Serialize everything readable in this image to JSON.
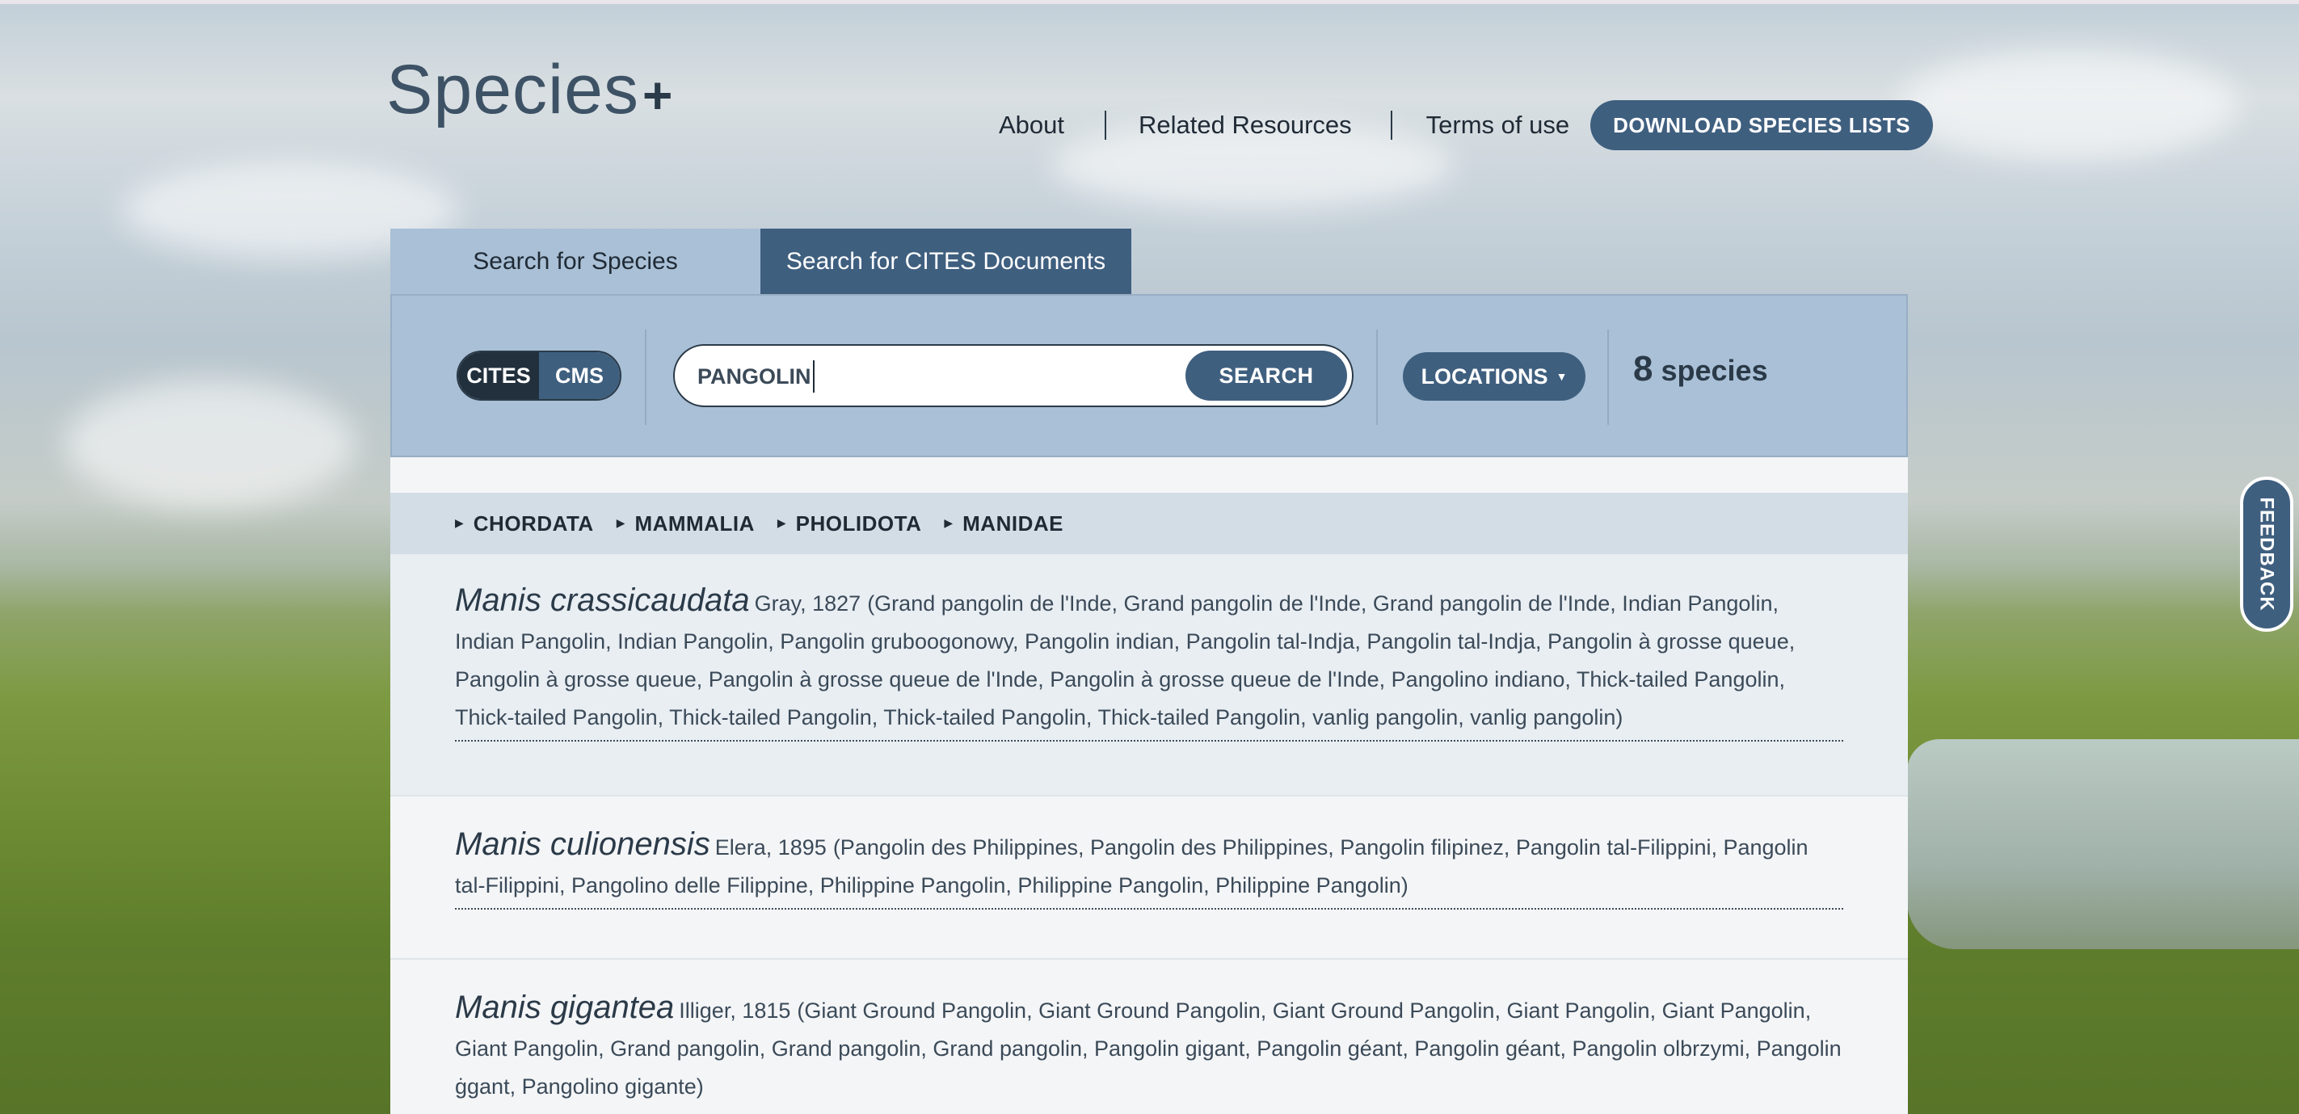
{
  "brand": {
    "name": "Species",
    "plus": "+"
  },
  "nav": {
    "about": "About",
    "related": "Related Resources",
    "terms": "Terms of use",
    "download_button": "DOWNLOAD SPECIES LISTS"
  },
  "tabs": {
    "species": "Search for Species",
    "documents": "Search for CITES Documents"
  },
  "search": {
    "toggle": {
      "cites": "CITES",
      "cms": "CMS",
      "selected": "CITES"
    },
    "query": "PANGOLIN",
    "button": "SEARCH",
    "locations_button": "LOCATIONS",
    "result_count": "8",
    "result_label": "species"
  },
  "taxonomy": [
    "CHORDATA",
    "MAMMALIA",
    "PHOLIDOTA",
    "MANIDAE"
  ],
  "results": [
    {
      "scientific_name": "Manis crassicaudata",
      "author": "Gray, 1827",
      "common_names": "(Grand pangolin de l'Inde, Grand pangolin de l'Inde, Grand pangolin de l'Inde, Indian Pangolin, Indian Pangolin, Indian Pangolin, Pangolin gruboogonowy, Pangolin indian, Pangolin tal-Indja, Pangolin tal-Indja, Pangolin à grosse queue, Pangolin à grosse queue, Pangolin à grosse queue de l'Inde, Pangolin à grosse queue de l'Inde, Pangolino indiano, Thick-tailed Pangolin, Thick-tailed Pangolin, Thick-tailed Pangolin, Thick-tailed Pangolin, Thick-tailed Pangolin, vanlig pangolin, vanlig pangolin)"
    },
    {
      "scientific_name": "Manis culionensis",
      "author": "Elera, 1895",
      "common_names": "(Pangolin des Philippines, Pangolin des Philippines, Pangolin filipinez, Pangolin tal-Filippini, Pangolin tal-Filippini, Pangolino delle Filippine, Philippine Pangolin, Philippine Pangolin, Philippine Pangolin)"
    },
    {
      "scientific_name": "Manis gigantea",
      "author": "Illiger, 1815",
      "common_names": "(Giant Ground Pangolin, Giant Ground Pangolin, Giant Ground Pangolin, Giant Pangolin, Giant Pangolin, Giant Pangolin, Grand pangolin, Grand pangolin, Grand pangolin, Pangolin gigant, Pangolin géant, Pangolin géant, Pangolin olbrzymi, Pangolin ġgant, Pangolino gigante)"
    }
  ],
  "feedback": "FEEDBACK",
  "colors": {
    "accent": "#3f5f7f",
    "dark": "#22303d",
    "panel": "#a9c0d6",
    "crumb_bar": "#d2dde6"
  }
}
